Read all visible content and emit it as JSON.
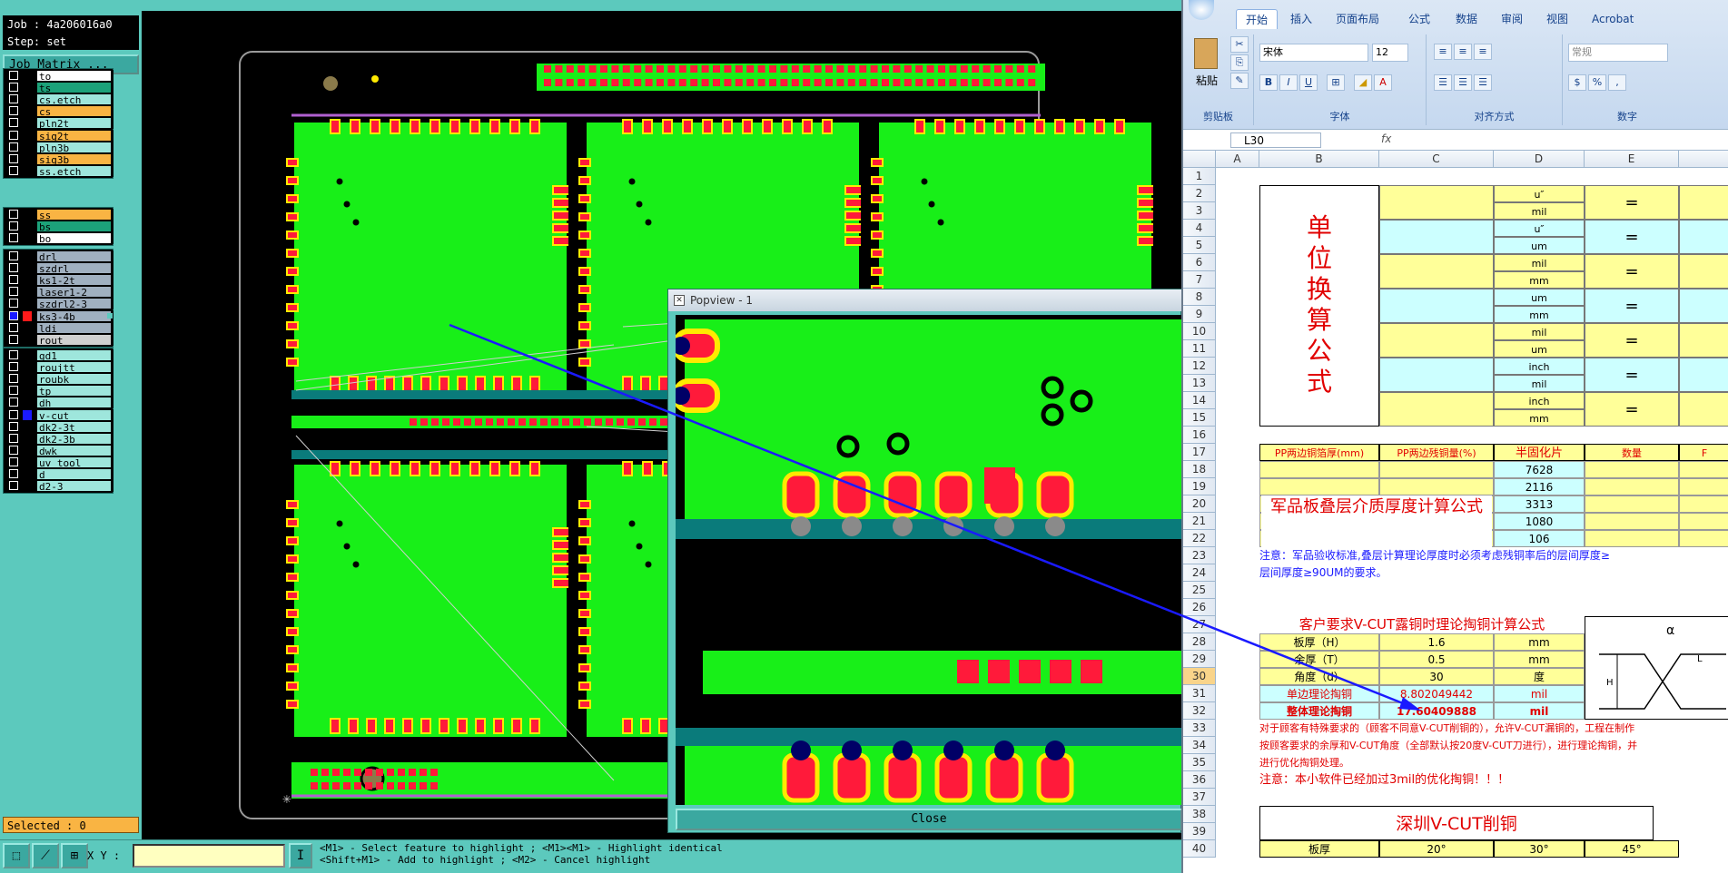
{
  "left_panel": {
    "job_label": "Job : 4a206016a0",
    "step_label": "Step: set",
    "job_matrix_button": "Job Matrix ...",
    "selected_label": "Selected : 0",
    "groups": [
      [
        {
          "name": "to",
          "color": "#ffffff"
        },
        {
          "name": "ts",
          "color": "#1ca27a"
        },
        {
          "name": "cs.etch",
          "color": "#9ee6dc"
        },
        {
          "name": "cs",
          "color": "#f9b443"
        },
        {
          "name": "pln2t",
          "color": "#9ee6dc"
        },
        {
          "name": "sig2t",
          "color": "#f9b443"
        },
        {
          "name": "pln3b",
          "color": "#9ee6dc"
        },
        {
          "name": "sig3b",
          "color": "#f9b443"
        },
        {
          "name": "ss.etch",
          "color": "#9ee6dc"
        }
      ],
      [
        {
          "name": "ss",
          "color": "#f9b443"
        },
        {
          "name": "bs",
          "color": "#1ca27a"
        },
        {
          "name": "bo",
          "color": "#ffffff"
        }
      ],
      [
        {
          "name": "drl",
          "color": "#a0b0c0"
        },
        {
          "name": "szdrl",
          "color": "#a0b0c0"
        },
        {
          "name": "ks1-2t",
          "color": "#a0b0c0"
        },
        {
          "name": "laser1-2",
          "color": "#a0b0c0"
        },
        {
          "name": "szdrl2-3",
          "color": "#a0b0c0"
        },
        {
          "name": "ks3-4b",
          "color": "#a0b0c0",
          "active": true
        },
        {
          "name": "ldi",
          "color": "#a0b0c0"
        },
        {
          "name": "rout",
          "color": "#d0d0d0"
        }
      ],
      [
        {
          "name": "gd1",
          "color": "#9ee6dc"
        },
        {
          "name": "roujtt",
          "color": "#9ee6dc"
        },
        {
          "name": "roubk",
          "color": "#9ee6dc"
        },
        {
          "name": "tp",
          "color": "#9ee6dc"
        },
        {
          "name": "dh",
          "color": "#9ee6dc"
        },
        {
          "name": "v-cut",
          "color": "#9ee6dc",
          "on": true
        },
        {
          "name": "dk2-3t",
          "color": "#9ee6dc"
        },
        {
          "name": "dk2-3b",
          "color": "#9ee6dc"
        },
        {
          "name": "dwk",
          "color": "#9ee6dc"
        },
        {
          "name": "uv_tool",
          "color": "#9ee6dc"
        },
        {
          "name": "d",
          "color": "#9ee6dc"
        },
        {
          "name": "d2-3",
          "color": "#9ee6dc"
        }
      ]
    ]
  },
  "bottom_bar": {
    "xy_label": "X Y :",
    "xy_value": "",
    "hint_line1": "<M1> - Select feature to highlight ; <M1><M1> - Highlight identical",
    "hint_line2": "<Shift+M1> - Add to highlight ; <M2> - Cancel highlight"
  },
  "popview": {
    "title": "Popview - 1",
    "close_label": "Close"
  },
  "excel": {
    "tabs": [
      "开始",
      "插入",
      "页面布局",
      "公式",
      "数据",
      "审阅",
      "视图",
      "Acrobat"
    ],
    "font_name": "宋体",
    "font_size": "12",
    "number_format": "常规",
    "group_labels": [
      "剪贴板",
      "字体",
      "对齐方式",
      "数字"
    ],
    "paste_label": "粘贴",
    "name_box": "L30",
    "fx": "fx",
    "columns": [
      "A",
      "B",
      "C",
      "D",
      "E"
    ],
    "rows": [
      "1",
      "2",
      "3",
      "4",
      "5",
      "6",
      "7",
      "8",
      "9",
      "10",
      "11",
      "12",
      "13",
      "14",
      "15",
      "16",
      "17",
      "18",
      "19",
      "20",
      "21",
      "22",
      "23",
      "24",
      "25",
      "26",
      "27",
      "28",
      "29",
      "30",
      "31",
      "32",
      "33",
      "34",
      "35",
      "36",
      "37",
      "38",
      "39",
      "40"
    ],
    "unit_title": "单位换算公式",
    "unit_pairs": [
      [
        "u″",
        "mil"
      ],
      [
        "u″",
        "um"
      ],
      [
        "mil",
        "mm"
      ],
      [
        "um",
        "mm"
      ],
      [
        "mil",
        "um"
      ],
      [
        "inch",
        "mil"
      ],
      [
        "inch",
        "mm"
      ]
    ],
    "eq": "=",
    "pp_headers": [
      "PP两边铜箔厚(mm)",
      "PP两边残铜量(%)",
      "半固化片",
      "数量",
      "F"
    ],
    "pp_types": [
      "7628",
      "2116",
      "3313",
      "1080",
      "106"
    ],
    "army_title": "军品板叠层介质厚度计算公式",
    "note1a": "注意：军品验收标准,叠层计算理论厚度时必须考虑残铜率后的层间厚度≥",
    "note1b": "层间厚度≥90UM的要求。",
    "vcut_title": "客户要求V-CUT露铜时理论掏铜计算公式",
    "vcut_rows": [
      [
        "板厚（H）",
        "1.6",
        "mm"
      ],
      [
        "余厚（T）",
        "0.5",
        "mm"
      ],
      [
        "角度（d）",
        "30",
        "度"
      ],
      [
        "单边理论掏铜",
        "8.802049442",
        "mil"
      ],
      [
        "整体理论掏铜",
        "17.60409888",
        "mil"
      ]
    ],
    "note2a": "对于顾客有特殊要求的（顾客不同意V-CUT削铜的），允许V-CUT漏铜的，工程在制作",
    "note2b": "按顾客要求的余厚和V-CUT角度（全部默认按20度V-CUT刀进行），进行理论掏铜，并",
    "note2c": "进行优化掏铜处理。",
    "note3": "注意：本小软件已经加过3mil的优化掏铜！！！",
    "sz_title": "深圳V-CUT削铜",
    "sz_head": [
      "板厚",
      "20°",
      "30°",
      "45°"
    ],
    "diagram_labels": [
      "α",
      "L",
      "H"
    ]
  }
}
